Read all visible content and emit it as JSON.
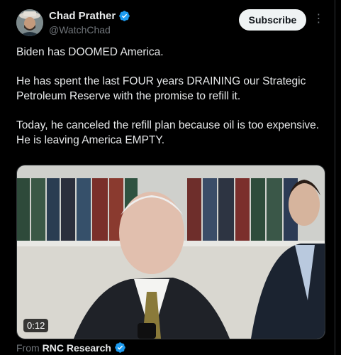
{
  "author": {
    "name": "Chad Prather",
    "handle": "@WatchChad",
    "verified_color": "#1d9bf0"
  },
  "actions": {
    "subscribe_label": "Subscribe",
    "more_label": "⋮"
  },
  "post": {
    "paragraphs": [
      "Biden has DOOMED America.",
      "He has spent the last FOUR years DRAINING our Strategic Petroleum Reserve with the promise to refill it.",
      "Today, he canceled the refill plan because oil is too expensive. He is leaving America EMPTY."
    ]
  },
  "media": {
    "duration": "0:12"
  },
  "source": {
    "from_label": "From",
    "name": "RNC Research"
  }
}
